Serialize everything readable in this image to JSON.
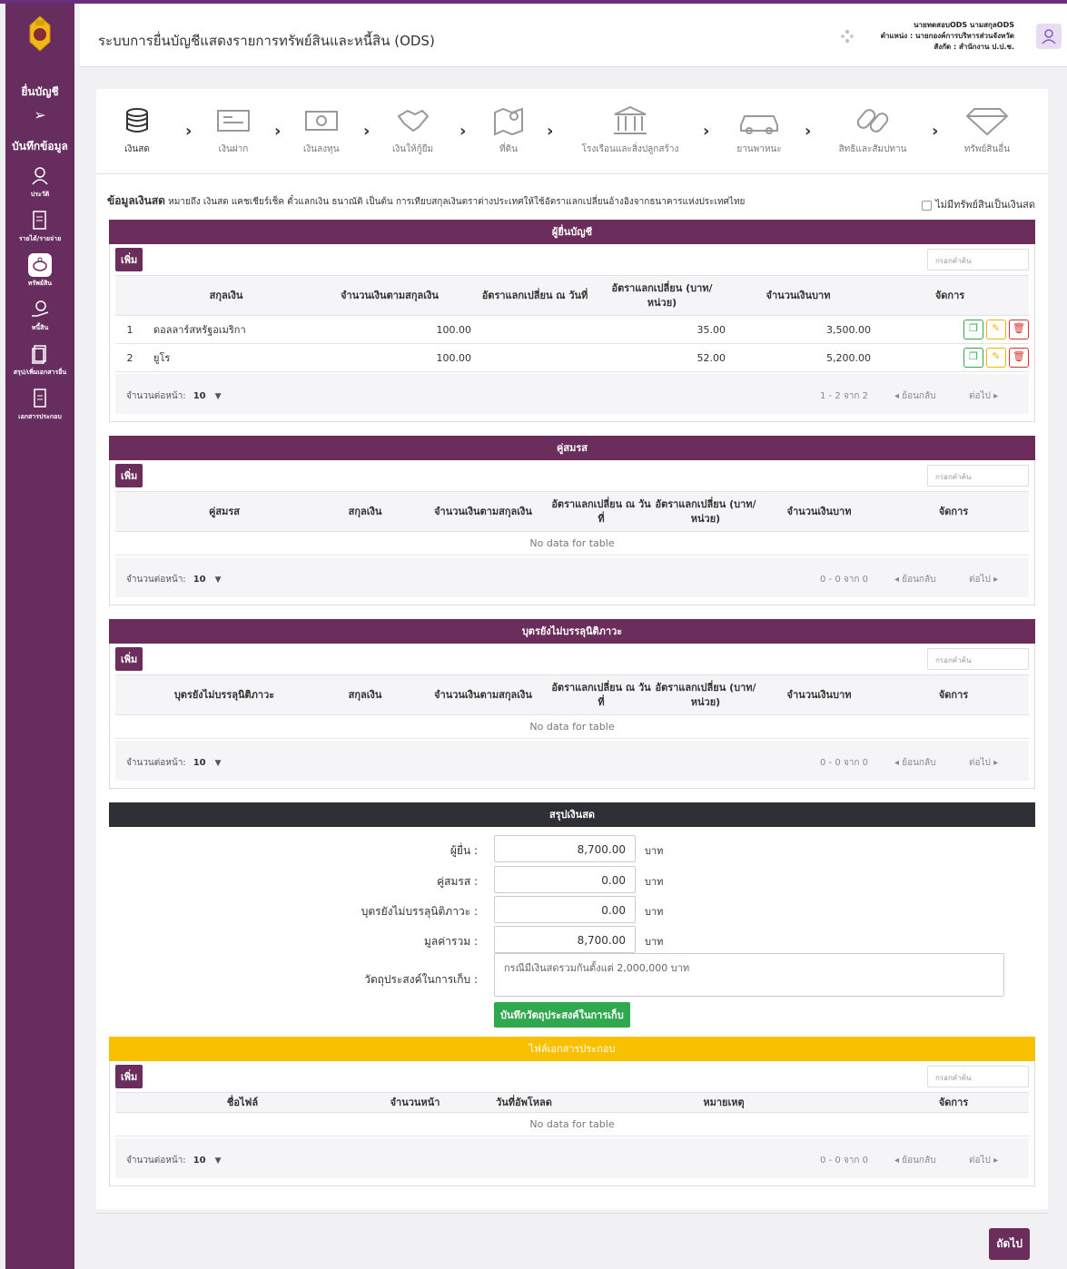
{
  "app": {
    "title": "ระบบการยื่นบัญชีแสดงรายการทรัพย์สินและหนี้สิน (ODS)",
    "user_name": "นายทดสอบODS นามสกุลODS",
    "user_position": "ตำแหน่ง : นายกองค์การบริหารส่วนจังหวัด",
    "user_org": "สังกัด : สำนักงาน ป.ป.ช."
  },
  "sidebar": {
    "section1": "ยื่นบัญชี",
    "section2": "บันทึกข้อมูล",
    "items": [
      {
        "label": "ประวัติ",
        "icon": "person-icon"
      },
      {
        "label": "รายได้/รายจ่าย",
        "icon": "document-icon"
      },
      {
        "label": "ทรัพย์สิน",
        "icon": "piggy-bank-icon"
      },
      {
        "label": "หนี้สิน",
        "icon": "hand-money-icon"
      },
      {
        "label": "สรุป/เพิ่มเอกสารอื่น",
        "icon": "files-icon"
      },
      {
        "label": "เอกสารประกอบ",
        "icon": "doc-attach-icon"
      }
    ]
  },
  "steps": [
    {
      "label": "เงินสด",
      "icon": "coins-icon",
      "active": true
    },
    {
      "label": "เงินฝาก",
      "icon": "deposit-card-icon"
    },
    {
      "label": "เงินลงทุน",
      "icon": "money-bill-icon"
    },
    {
      "label": "เงินให้กู้ยืม",
      "icon": "handshake-icon"
    },
    {
      "label": "ที่ดิน",
      "icon": "map-pin-icon"
    },
    {
      "label": "โรงเรือนและสิ่งปลูกสร้าง",
      "icon": "bank-building-icon"
    },
    {
      "label": "ยานพาหนะ",
      "icon": "car-icon"
    },
    {
      "label": "สิทธิและสัมปทาน",
      "icon": "chain-link-icon"
    },
    {
      "label": "ทรัพย์สินอื่น",
      "icon": "diamond-icon"
    }
  ],
  "info": {
    "title": "ข้อมูลเงินสด",
    "text": "หมายถึง เงินสด แคชเชียร์เช็ค ตั๋วแลกเงิน ธนาณัติ เป็นต้น การเทียบสกุลเงินตราต่างประเทศให้ใช้อัตราแลกเปลี่ยนอ้างอิงจากธนาคารแห่งประเทศไทย",
    "no_asset_label": "ไม่มีทรัพย์สินเป็นเงินสด"
  },
  "common": {
    "add_label": "เพิ่ม",
    "search_placeholder": "กรอกคำค้น",
    "per_page_label": "จำนวนต่อหน้า:",
    "per_page_value": "10",
    "back_label": "ย้อนกลับ",
    "next_label": "ต่อไป",
    "no_data": "No data for table"
  },
  "filer_section": {
    "title": "ผู้ยื่นบัญชี",
    "headers": [
      "",
      "สกุลเงิน",
      "จำนวนเงินตามสกุลเงิน",
      "อัตราแลกเปลี่ยน ณ วันที่",
      "อัตราแลกเปลี่ยน (บาท/หน่วย)",
      "จำนวนเงินบาท",
      "จัดการ"
    ],
    "rows": [
      {
        "no": "1",
        "currency": "ดอลลาร์สหรัฐอเมริกา",
        "amount": "100.00",
        "date": "",
        "rate": "35.00",
        "baht": "3,500.00"
      },
      {
        "no": "2",
        "currency": "ยูโร",
        "amount": "100.00",
        "date": "",
        "rate": "52.00",
        "baht": "5,200.00"
      }
    ],
    "range": "1 - 2 จาก 2"
  },
  "spouse_section": {
    "title": "คู่สมรส",
    "headers": [
      "",
      "คู่สมรส",
      "สกุลเงิน",
      "จำนวนเงินตามสกุลเงิน",
      "อัตราแลกเปลี่ยน ณ วันที่",
      "อัตราแลกเปลี่ยน (บาท/หน่วย)",
      "จำนวนเงินบาท",
      "จัดการ"
    ],
    "range": "0 - 0 จาก 0"
  },
  "child_section": {
    "title": "บุตรยังไม่บรรลุนิติภาวะ",
    "headers": [
      "",
      "บุตรยังไม่บรรลุนิติภาวะ",
      "สกุลเงิน",
      "จำนวนเงินตามสกุลเงิน",
      "อัตราแลกเปลี่ยน ณ วันที่",
      "อัตราแลกเปลี่ยน (บาท/หน่วย)",
      "จำนวนเงินบาท",
      "จัดการ"
    ],
    "range": "0 - 0 จาก 0"
  },
  "summary": {
    "title": "สรุปเงินสด",
    "filer_label": "ผู้ยื่น :",
    "filer_value": "8,700.00",
    "spouse_label": "คู่สมรส :",
    "spouse_value": "0.00",
    "child_label": "บุตรยังไม่บรรลุนิติภาวะ :",
    "child_value": "0.00",
    "total_label": "มูลค่ารวม :",
    "total_value": "8,700.00",
    "unit": "บาท",
    "purpose_label": "วัตถุประสงค์ในการเก็บ :",
    "purpose_placeholder": "กรณีมีเงินสดรวมกันตั้งแต่ 2,000,000 บาท",
    "save_label": "บันทึกวัตถุประสงค์ในการเก็บ"
  },
  "files_section": {
    "title": "ไฟล์เอกสารประกอบ",
    "headers": [
      "",
      "ชื่อไฟล์",
      "จำนวนหน้า",
      "วันที่อัพโหลด",
      "หมายเหตุ",
      "จัดการ"
    ],
    "range": "0 - 0 จาก 0"
  },
  "next_button": "ถัดไป",
  "colors": {
    "primary": "#6b2d5c",
    "summary": "#2d3034",
    "files": "#f8c000",
    "success": "#2fa84f"
  }
}
